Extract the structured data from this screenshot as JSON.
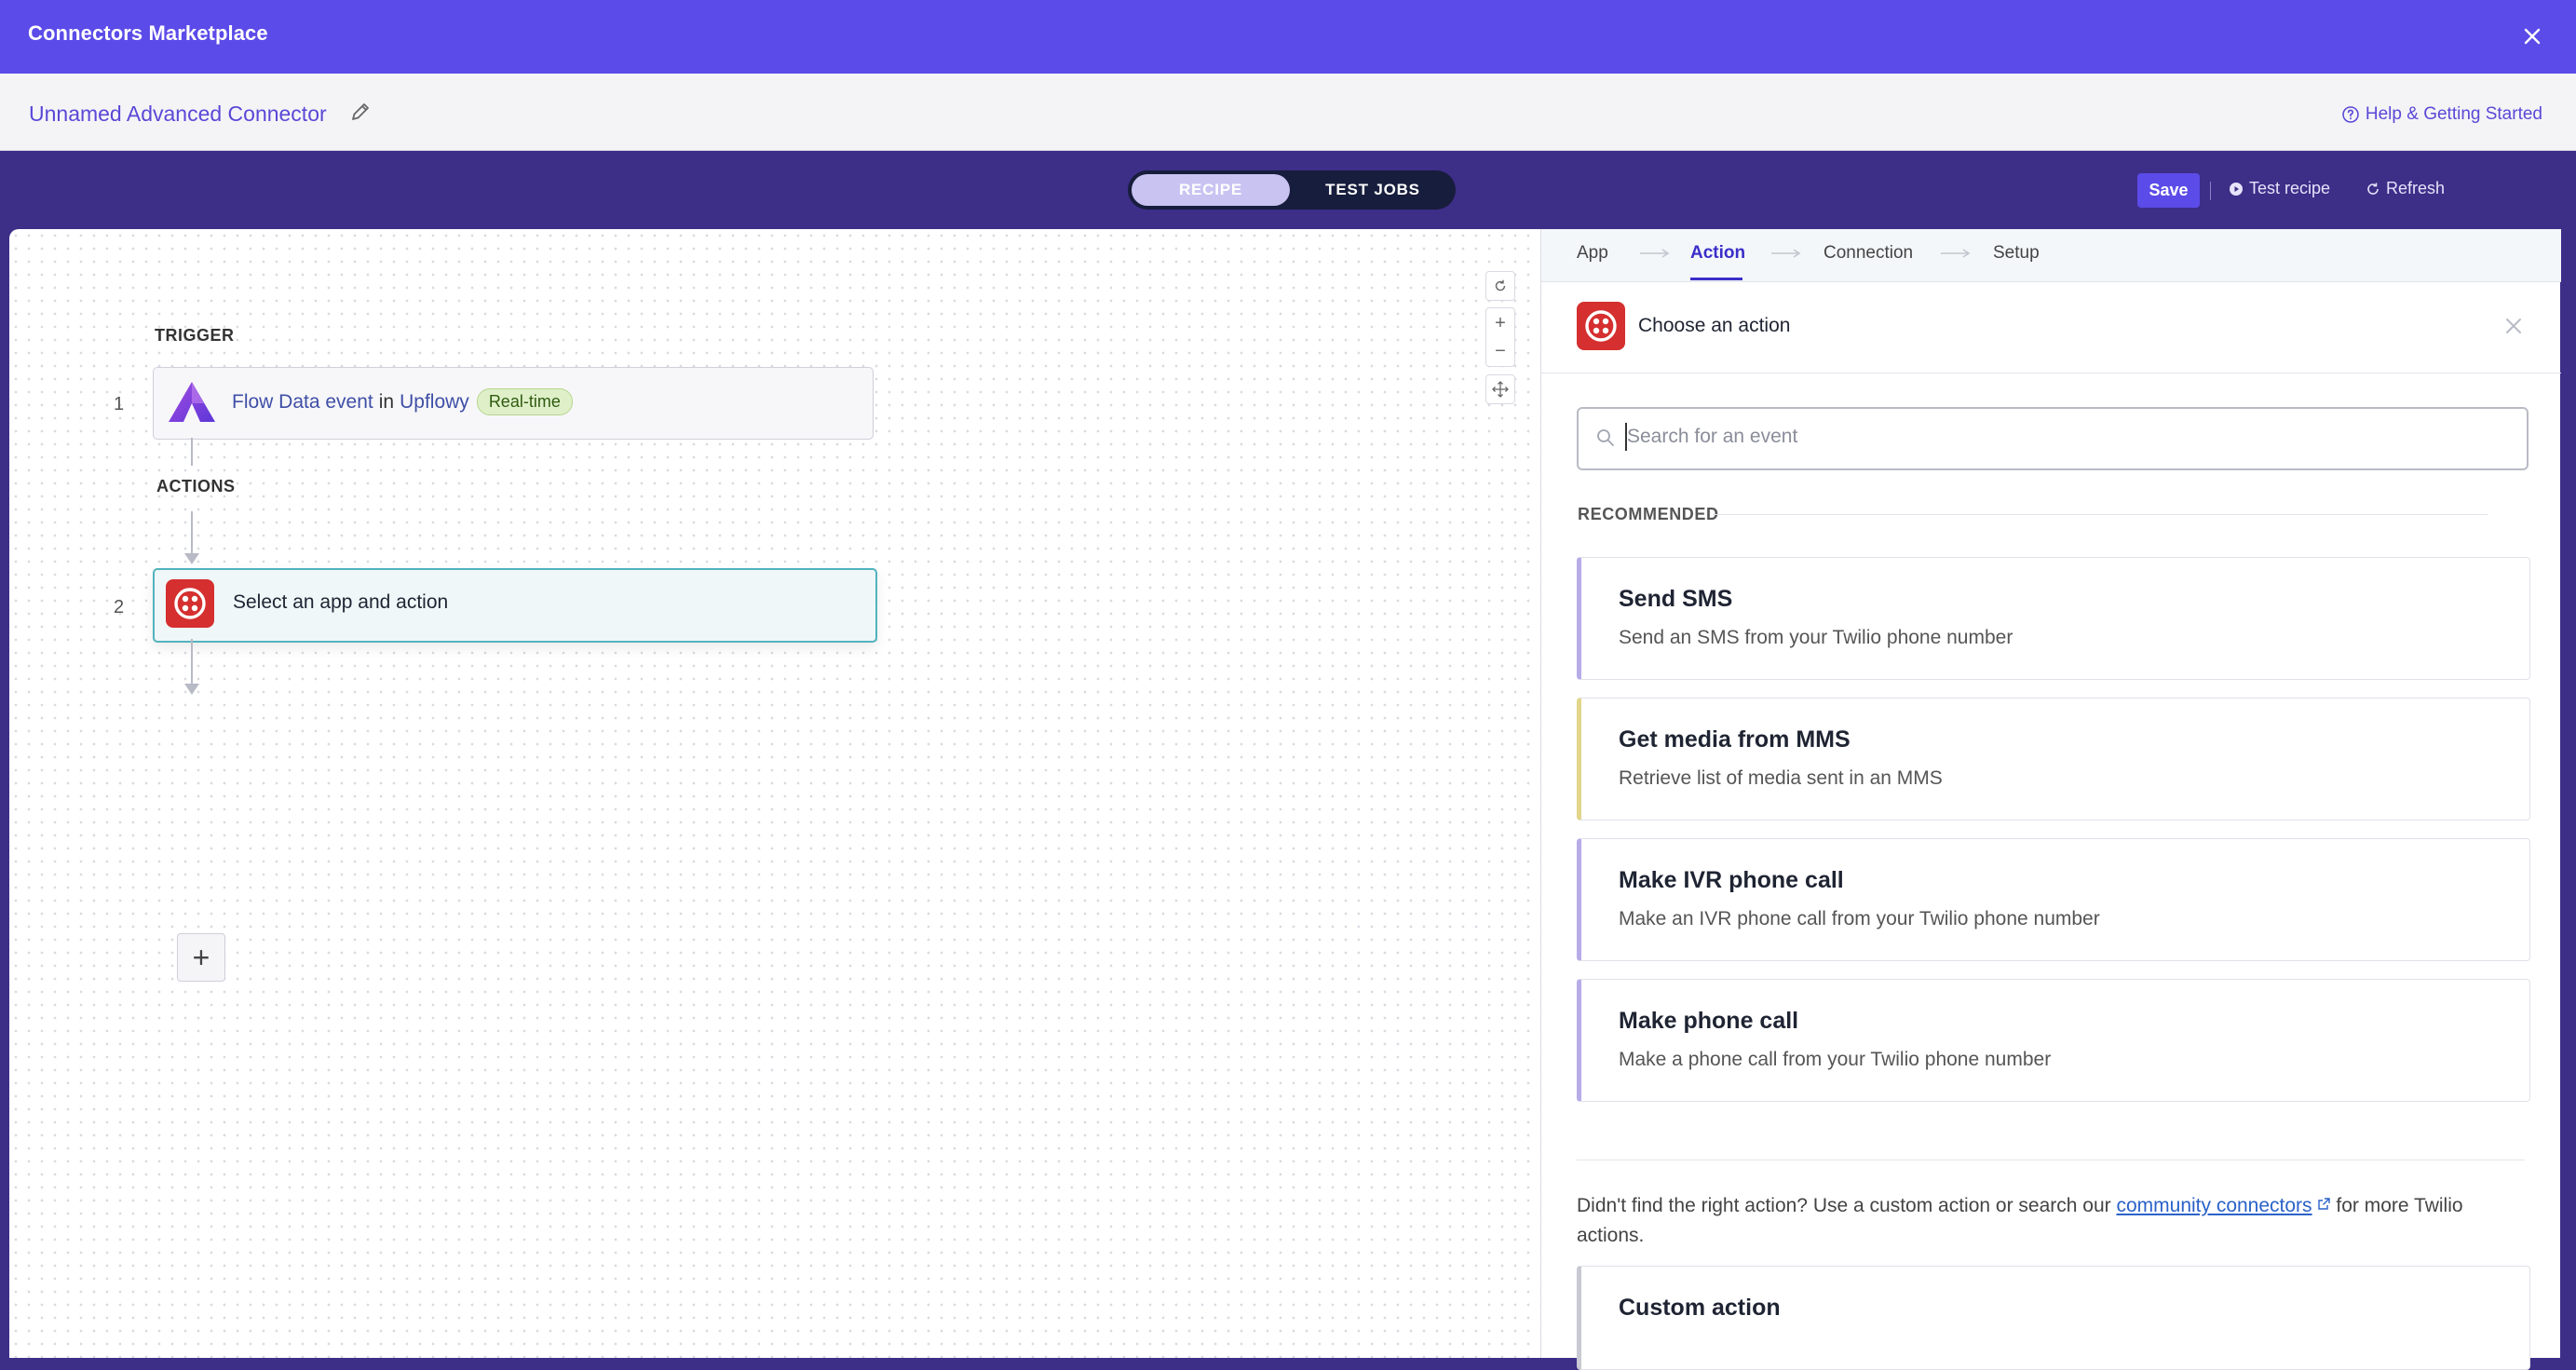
{
  "topbar": {
    "title": "Connectors Marketplace"
  },
  "subheader": {
    "connector_name": "Unnamed Advanced Connector",
    "help_link": "Help & Getting Started"
  },
  "toolbar": {
    "tabs": [
      "RECIPE",
      "TEST JOBS"
    ],
    "save_label": "Save",
    "test_recipe_label": "Test recipe",
    "refresh_label": "Refresh"
  },
  "canvas": {
    "trigger_label": "TRIGGER",
    "actions_label": "ACTIONS",
    "step1": {
      "number": "1",
      "event_text": "Flow Data event",
      "in_text": "in",
      "app_name": "Upflowy",
      "badge": "Real-time"
    },
    "step2": {
      "number": "2",
      "text": "Select an app and action"
    }
  },
  "panel": {
    "tabs": [
      "App",
      "Action",
      "Connection",
      "Setup"
    ],
    "header_title": "Choose an action",
    "search_placeholder": "Search for an event",
    "recommended_label": "RECOMMENDED",
    "actions": [
      {
        "title": "Send SMS",
        "desc": "Send an SMS from your Twilio phone number",
        "accent": "#b7ace8"
      },
      {
        "title": "Get media from MMS",
        "desc": "Retrieve list of media sent in an MMS",
        "accent": "#e2d58c"
      },
      {
        "title": "Make IVR phone call",
        "desc": "Make an IVR phone call from your Twilio phone number",
        "accent": "#b7ace8"
      },
      {
        "title": "Make phone call",
        "desc": "Make a phone call from your Twilio phone number",
        "accent": "#b7ace8"
      }
    ],
    "footnote_prefix": "Didn't find the right action? Use a custom action or search our ",
    "footnote_link": "community connectors",
    "footnote_suffix": " for more Twilio actions.",
    "custom_action_title": "Custom action"
  },
  "colors": {
    "brand": "#5b4be8",
    "toolbar_bg": "#3d2e88",
    "twilio_red": "#d52f2f",
    "selected_border": "#52b3bd"
  }
}
